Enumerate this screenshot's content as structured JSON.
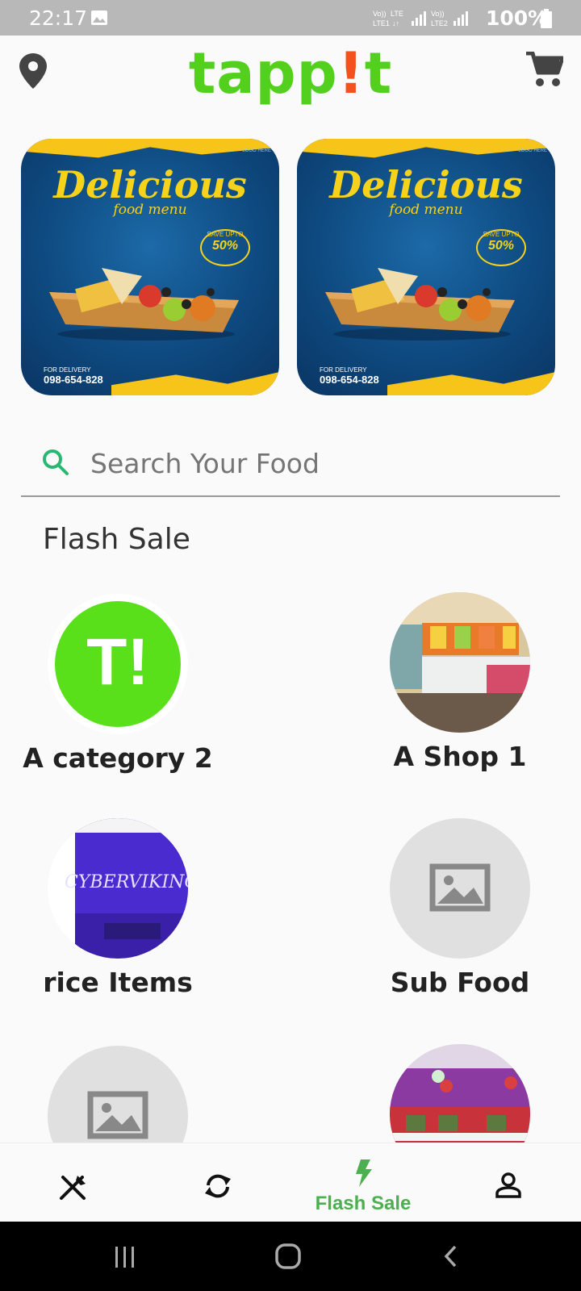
{
  "status_bar": {
    "time": "22:17",
    "network_1": "Vo)) LTE1",
    "network_2": "LTE",
    "network_3": "Vo)) LTE2",
    "battery": "100%"
  },
  "header": {
    "logo_main": "tapp",
    "logo_bang": "!",
    "logo_end": "t"
  },
  "banners": [
    {
      "title": "Delicious",
      "subtitle": "food menu",
      "badge_small": "SAVE UPTO",
      "badge_value": "50%",
      "delivery_label": "FOR DELIVERY",
      "phone": "098-654-828",
      "logo_text": "LOGO HERE"
    },
    {
      "title": "Delicious",
      "subtitle": "food menu",
      "badge_small": "SAVE UPTO",
      "badge_value": "50%",
      "delivery_label": "FOR DELIVERY",
      "phone": "098-654-828",
      "logo_text": "LOGO HERE"
    }
  ],
  "search": {
    "placeholder": "Search Your Food"
  },
  "section": {
    "title": "Flash Sale"
  },
  "items": [
    {
      "label": "A category 2",
      "image": "tappit-logo"
    },
    {
      "label": "A Shop 1",
      "image": "shop-interior"
    },
    {
      "label": "rice Items",
      "image": "neon-sign",
      "image_text": "CYBERVIKING"
    },
    {
      "label": "Sub Food",
      "image": "placeholder-image"
    },
    {
      "label": "",
      "image": "placeholder-image"
    },
    {
      "label": "",
      "image": "store-front"
    }
  ],
  "bottom_nav": {
    "flash_sale_label": "Flash Sale"
  },
  "colors": {
    "brand_green": "#52d01d",
    "accent_orange": "#f4511e",
    "nav_active": "#4caf50"
  }
}
